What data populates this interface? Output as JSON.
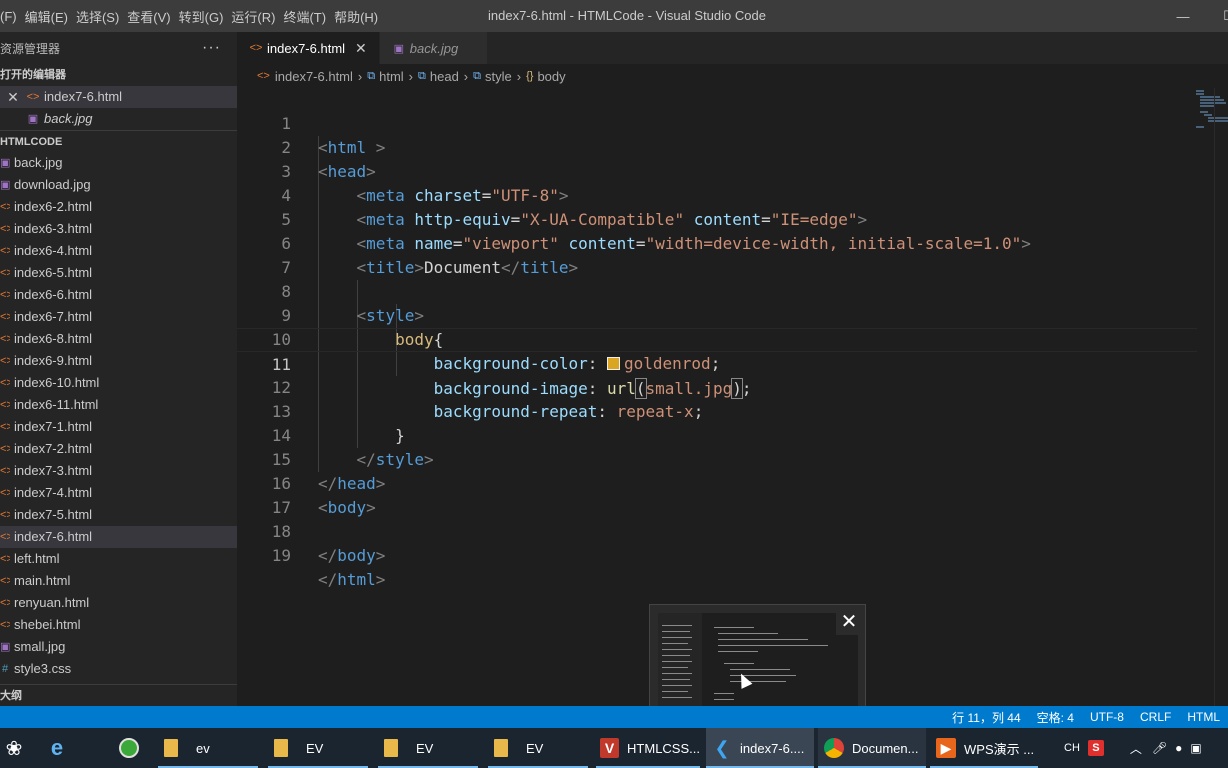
{
  "menu": [
    "(F)",
    "编辑(E)",
    "选择(S)",
    "查看(V)",
    "转到(G)",
    "运行(R)",
    "终端(T)",
    "帮助(H)"
  ],
  "window_title": "index7-6.html - HTMLCode - Visual Studio Code",
  "window_controls": {
    "minimize": "—",
    "maximize": "☐"
  },
  "explorer": {
    "title": "资源管理器",
    "more": "···",
    "open_editors_title": "打开的编辑器",
    "open_editors": [
      {
        "name": "index7-6.html",
        "type": "html",
        "active": true
      },
      {
        "name": "back.jpg",
        "type": "image",
        "italic": true
      }
    ],
    "folder_title": "HTMLCODE",
    "files": [
      {
        "name": "back.jpg",
        "type": "image"
      },
      {
        "name": "download.jpg",
        "type": "image"
      },
      {
        "name": "index6-2.html",
        "type": "html"
      },
      {
        "name": "index6-3.html",
        "type": "html"
      },
      {
        "name": "index6-4.html",
        "type": "html"
      },
      {
        "name": "index6-5.html",
        "type": "html"
      },
      {
        "name": "index6-6.html",
        "type": "html"
      },
      {
        "name": "index6-7.html",
        "type": "html"
      },
      {
        "name": "index6-8.html",
        "type": "html"
      },
      {
        "name": "index6-9.html",
        "type": "html"
      },
      {
        "name": "index6-10.html",
        "type": "html"
      },
      {
        "name": "index6-11.html",
        "type": "html"
      },
      {
        "name": "index7-1.html",
        "type": "html"
      },
      {
        "name": "index7-2.html",
        "type": "html"
      },
      {
        "name": "index7-3.html",
        "type": "html"
      },
      {
        "name": "index7-4.html",
        "type": "html"
      },
      {
        "name": "index7-5.html",
        "type": "html"
      },
      {
        "name": "index7-6.html",
        "type": "html",
        "selected": true
      },
      {
        "name": "left.html",
        "type": "html"
      },
      {
        "name": "main.html",
        "type": "html"
      },
      {
        "name": "renyuan.html",
        "type": "html"
      },
      {
        "name": "shebei.html",
        "type": "html"
      },
      {
        "name": "small.jpg",
        "type": "image"
      },
      {
        "name": "style3.css",
        "type": "css"
      }
    ],
    "outline_title": "大纲"
  },
  "tabs": [
    {
      "label": "index7-6.html",
      "active": true,
      "close": "✕"
    },
    {
      "label": "back.jpg",
      "active": false,
      "italic": true
    }
  ],
  "breadcrumb": [
    "index7-6.html",
    "html",
    "head",
    "style",
    "body"
  ],
  "editor": {
    "current_line": 11,
    "line_numbers": [
      "1",
      "2",
      "3",
      "4",
      "5",
      "6",
      "7",
      "8",
      "9",
      "10",
      "11",
      "12",
      "13",
      "14",
      "15",
      "16",
      "17",
      "18",
      "19"
    ],
    "code": {
      "l1": {
        "open": "<",
        "tag": "html",
        "close": " >"
      },
      "l2": {
        "open": "<",
        "tag": "head",
        "close": ">"
      },
      "l3": {
        "open": "<",
        "tag": "meta",
        "attr1": "charset",
        "eq": "=",
        "val1": "\"UTF-8\"",
        "close": ">"
      },
      "l4": {
        "open": "<",
        "tag": "meta",
        "attr1": "http-equiv",
        "val1": "\"X-UA-Compatible\"",
        "attr2": "content",
        "val2": "\"IE=edge\"",
        "close": ">"
      },
      "l5": {
        "open": "<",
        "tag": "meta",
        "attr1": "name",
        "val1": "\"viewport\"",
        "attr2": "content",
        "val2": "\"width=device-width, initial-scale=1.0\"",
        "close": ">"
      },
      "l6": {
        "open": "<",
        "tag": "title",
        "close": ">",
        "text": "Document",
        "end_open": "</",
        "end_tag": "title",
        "end_close": ">"
      },
      "l8": {
        "open": "<",
        "tag": "style",
        "close": ">"
      },
      "l9": {
        "selector": "body",
        "brace": "{"
      },
      "l10": {
        "prop": "background-color",
        "colon": ": ",
        "value": "goldenrod",
        "semi": ";"
      },
      "l11": {
        "prop": "background-image",
        "colon": ": ",
        "fn": "url",
        "paren_open": "(",
        "arg": "small.jpg",
        "paren_close": ")",
        "semi": ";"
      },
      "l12": {
        "prop": "background-repeat",
        "colon": ": ",
        "value": "repeat-x",
        "semi": ";"
      },
      "l13": {
        "brace": "}"
      },
      "l14": {
        "open": "</",
        "tag": "style",
        "close": ">"
      },
      "l15": {
        "open": "</",
        "tag": "head",
        "close": ">"
      },
      "l16": {
        "open": "<",
        "tag": "body",
        "close": ">"
      },
      "l18": {
        "open": "</",
        "tag": "body",
        "close": ">"
      },
      "l19": {
        "open": "</",
        "tag": "html",
        "close": ">"
      }
    },
    "swatch_color": "#daa520"
  },
  "preview": {
    "close": "✕"
  },
  "statusbar": {
    "items": [
      "行 11，列 44",
      "空格: 4",
      "UTF-8",
      "CRLF",
      "HTML"
    ]
  },
  "taskbar": {
    "items": [
      {
        "label": "ev",
        "icon": "folder-icon"
      },
      {
        "label": "EV",
        "icon": "folder-icon"
      },
      {
        "label": "EV",
        "icon": "folder-icon"
      },
      {
        "label": "EV",
        "icon": "folder-icon"
      },
      {
        "label": "HTMLCSS...",
        "icon": "wps-icon"
      },
      {
        "label": "index7-6....",
        "icon": "vscode-icon"
      },
      {
        "label": "Documen...",
        "icon": "chrome-icon"
      },
      {
        "label": "WPS演示 ...",
        "icon": "wps-presentation-icon"
      }
    ],
    "tray": {
      "ime": "CH",
      "sogou": "S"
    }
  }
}
